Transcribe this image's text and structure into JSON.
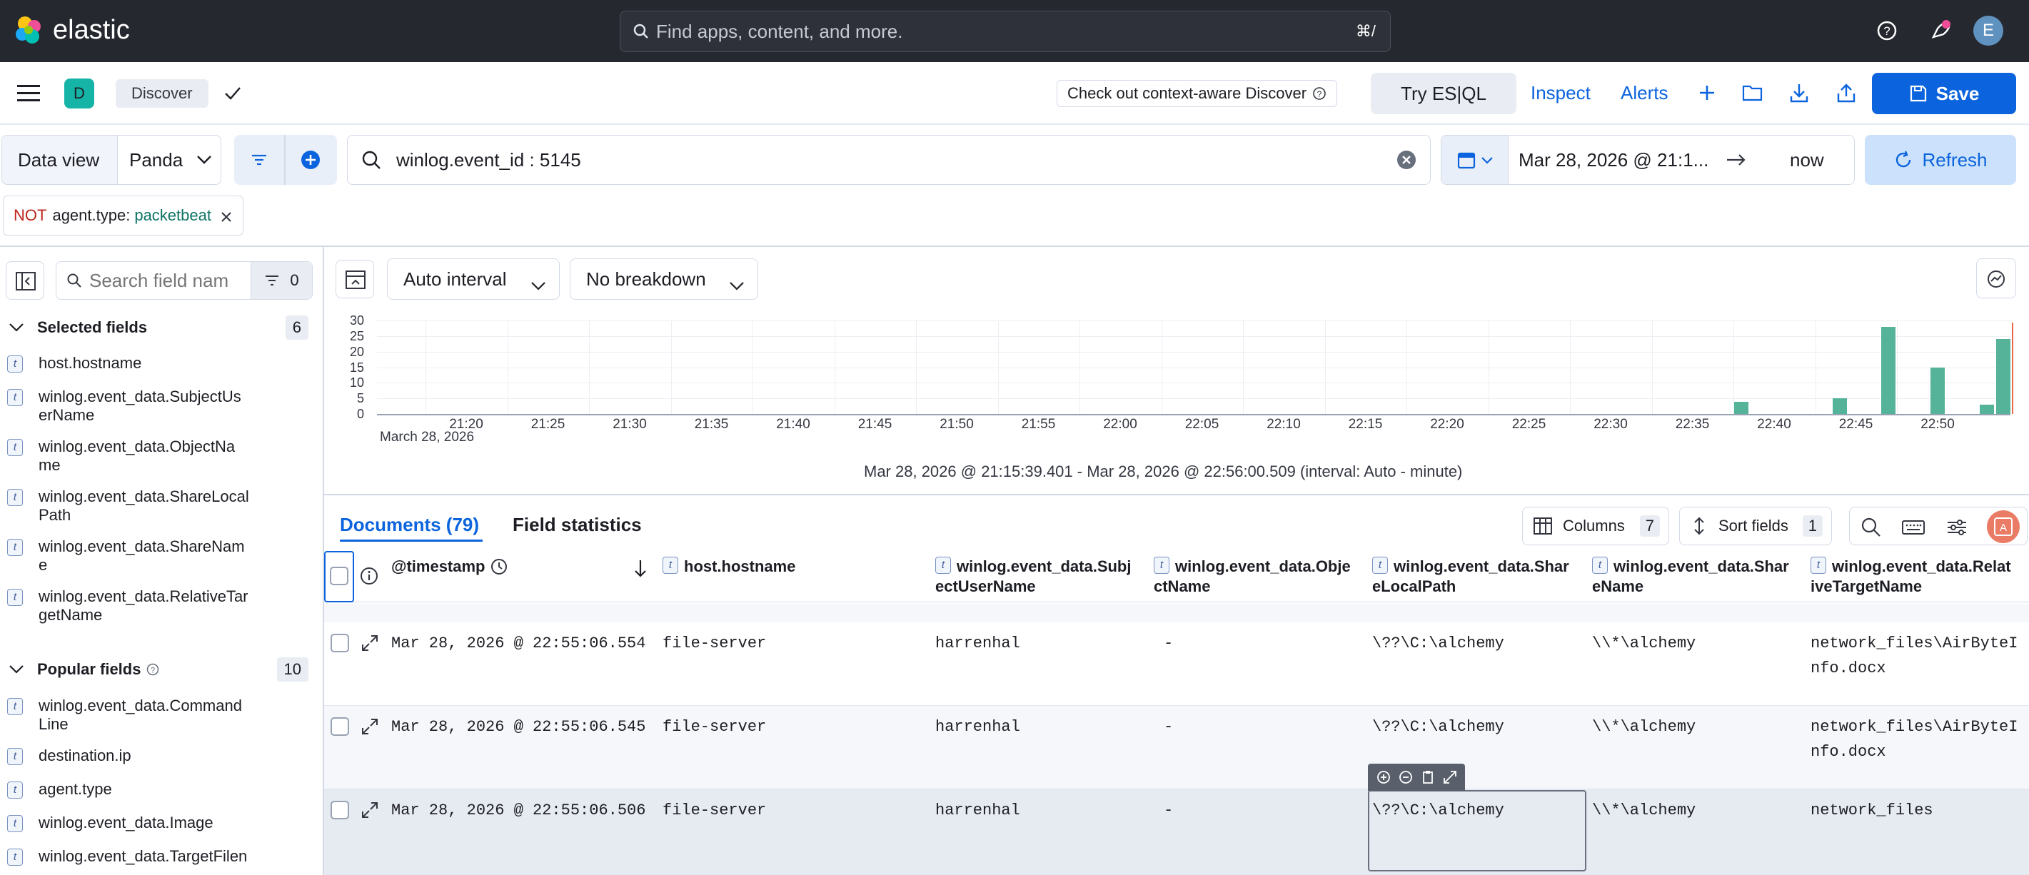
{
  "topbar": {
    "brand": "elastic",
    "search_placeholder": "Find apps, content, and more.",
    "search_shortcut": "⌘/",
    "avatar": "E"
  },
  "appbar": {
    "space_badge": "D",
    "breadcrumb": "Discover",
    "context_notice": "Check out context-aware Discover",
    "try_esql": "Try ES|QL",
    "inspect": "Inspect",
    "alerts": "Alerts",
    "save": "Save"
  },
  "querybar": {
    "data_view_label": "Data view",
    "data_view_value": "Panda",
    "query": "winlog.event_id : 5145",
    "date_start": "Mar 28, 2026 @ 21:1...",
    "date_end": "now",
    "refresh": "Refresh"
  },
  "filter_pill": {
    "negation": "NOT",
    "field": "agent.type:",
    "value": "packetbeat"
  },
  "sidebar": {
    "search_placeholder": "Search field names",
    "filter_count": "0",
    "selected_title": "Selected fields",
    "selected_count": "6",
    "selected_fields": [
      [
        "host.hostname"
      ],
      [
        "winlog.event_data.SubjectUs",
        "erName"
      ],
      [
        "winlog.event_data.ObjectNa",
        "me"
      ],
      [
        "winlog.event_data.ShareLocal",
        "Path"
      ],
      [
        "winlog.event_data.ShareNam",
        "e"
      ],
      [
        "winlog.event_data.RelativeTar",
        "getName"
      ]
    ],
    "popular_title": "Popular fields",
    "popular_count": "10",
    "popular_fields": [
      [
        "winlog.event_data.Command",
        "Line"
      ],
      [
        "destination.ip"
      ],
      [
        "agent.type"
      ],
      [
        "winlog.event_data.Image"
      ],
      [
        "winlog.event_data.TargetFilen"
      ]
    ]
  },
  "histogram_toolbar": {
    "interval": "Auto interval",
    "breakdown": "No breakdown"
  },
  "chart_data": {
    "type": "bar",
    "y_ticks": [
      "30",
      "25",
      "20",
      "15",
      "10",
      "5",
      "0"
    ],
    "ylim": [
      0,
      30
    ],
    "x_ticks": [
      "21:20",
      "21:25",
      "21:30",
      "21:35",
      "21:40",
      "21:45",
      "21:50",
      "21:55",
      "22:00",
      "22:05",
      "22:10",
      "22:15",
      "22:20",
      "22:25",
      "22:30",
      "22:35",
      "22:40",
      "22:45",
      "22:50"
    ],
    "x_sublabel": "March 28, 2026",
    "bars": [
      {
        "time": "22:38",
        "value": 4
      },
      {
        "time": "22:44",
        "value": 5
      },
      {
        "time": "22:47",
        "value": 28
      },
      {
        "time": "22:50",
        "value": 15
      },
      {
        "time": "22:53",
        "value": 3
      },
      {
        "time": "22:54",
        "value": 24
      }
    ],
    "caption": "Mar 28, 2026 @ 21:15:39.401 - Mar 28, 2026 @ 22:56:00.509 (interval: Auto - minute)",
    "color": "#54b399"
  },
  "docs_tabs": {
    "documents": "Documents (79)",
    "field_stats": "Field statistics",
    "columns": "Columns",
    "columns_count": "7",
    "sort": "Sort fields",
    "sort_count": "1"
  },
  "table": {
    "headers": [
      [
        "@timestamp"
      ],
      [
        "host.hostname"
      ],
      [
        "winlog.event_data.Subj",
        "ectUserName"
      ],
      [
        "winlog.event_data.Obje",
        "ctName"
      ],
      [
        "winlog.event_data.Shar",
        "eLocalPath"
      ],
      [
        "winlog.event_data.Shar",
        "eName"
      ],
      [
        "winlog.event_data.Relat",
        "iveTargetName"
      ]
    ],
    "rows": [
      [
        "Mar 28, 2026 @ 22:55:06.554",
        "file-server",
        "harrenhal",
        "-",
        "\\??\\C:\\alchemy",
        "\\\\*\\alchemy",
        [
          "network_files\\AirByteI",
          "nfo.docx"
        ]
      ],
      [
        "Mar 28, 2026 @ 22:55:06.545",
        "file-server",
        "harrenhal",
        "-",
        "\\??\\C:\\alchemy",
        "\\\\*\\alchemy",
        [
          "network_files\\AirByteI",
          "nfo.docx"
        ]
      ],
      [
        "Mar 28, 2026 @ 22:55:06.506",
        "file-server",
        "harrenhal",
        "-",
        "\\??\\C:\\alchemy",
        "\\\\*\\alchemy",
        [
          "network_files"
        ]
      ]
    ]
  },
  "colors": {
    "topbar": "#25282f",
    "primary": "#0b64dd",
    "bar": "#54b399",
    "badge": "#16b4a6"
  }
}
